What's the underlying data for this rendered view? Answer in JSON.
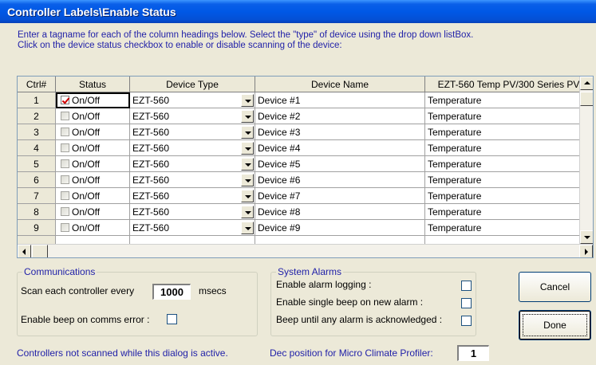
{
  "window": {
    "title": "Controller Labels\\Enable Status"
  },
  "instructions": {
    "line1": "Enter a tagname for each of the column headings below.  Select the \"type\" of device using the drop down listBox.",
    "line2": "Click on the device status checkbox to enable or disable scanning of the device:"
  },
  "grid": {
    "headers": [
      "Ctrl#",
      "Status",
      "Device Type",
      "Device Name",
      "EZT-560 Temp PV/300 Series PV"
    ],
    "rows": [
      {
        "num": "1",
        "status": "On/Off",
        "checked": true,
        "type": "EZT-560",
        "name": "Device #1",
        "pv": "Temperature"
      },
      {
        "num": "2",
        "status": "On/Off",
        "checked": false,
        "type": "EZT-560",
        "name": "Device #2",
        "pv": "Temperature"
      },
      {
        "num": "3",
        "status": "On/Off",
        "checked": false,
        "type": "EZT-560",
        "name": "Device #3",
        "pv": "Temperature"
      },
      {
        "num": "4",
        "status": "On/Off",
        "checked": false,
        "type": "EZT-560",
        "name": "Device #4",
        "pv": "Temperature"
      },
      {
        "num": "5",
        "status": "On/Off",
        "checked": false,
        "type": "EZT-560",
        "name": "Device #5",
        "pv": "Temperature"
      },
      {
        "num": "6",
        "status": "On/Off",
        "checked": false,
        "type": "EZT-560",
        "name": "Device #6",
        "pv": "Temperature"
      },
      {
        "num": "7",
        "status": "On/Off",
        "checked": false,
        "type": "EZT-560",
        "name": "Device #7",
        "pv": "Temperature"
      },
      {
        "num": "8",
        "status": "On/Off",
        "checked": false,
        "type": "EZT-560",
        "name": "Device #8",
        "pv": "Temperature"
      },
      {
        "num": "9",
        "status": "On/Off",
        "checked": false,
        "type": "EZT-560",
        "name": "Device #9",
        "pv": "Temperature"
      }
    ]
  },
  "communications": {
    "label": "Communications",
    "scan_prefix": "Scan each controller every",
    "scan_value": "1000",
    "scan_unit": "msecs",
    "beep_label": "Enable beep on comms error :",
    "beep_checked": false
  },
  "system_alarms": {
    "label": "System Alarms",
    "items": [
      {
        "label": "Enable alarm logging :",
        "checked": false
      },
      {
        "label": "Enable single beep on new alarm :",
        "checked": false
      },
      {
        "label": "Beep until any alarm is acknowledged :",
        "checked": false
      }
    ]
  },
  "buttons": {
    "cancel": "Cancel",
    "done": "Done"
  },
  "footer": {
    "note": "Controllers  not scanned while this dialog is active.",
    "dec_label": "Dec position for Micro Climate Profiler:",
    "dec_value": "1"
  },
  "colors": {
    "title_bar": "#0058e6",
    "accent_text": "#1f1fa8",
    "dialog_bg": "#ece9d8",
    "check_mark": "#d00000"
  }
}
